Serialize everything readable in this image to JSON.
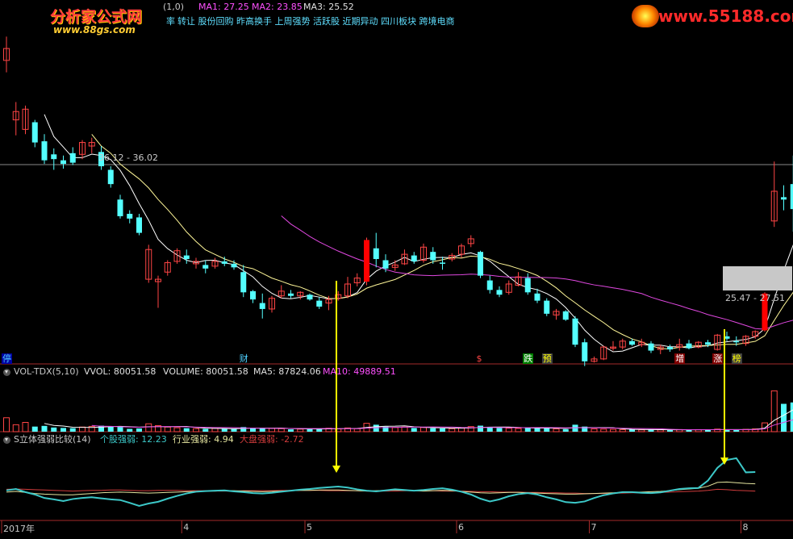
{
  "colors": {
    "bg": "#000000",
    "up": "#ff4545",
    "down": "#54ffff",
    "bigup": "#ff0000",
    "bigdown": "#00e600",
    "ma1": "#ffffff",
    "ma2": "#fff799",
    "ma3": "#e048e0",
    "grid": "#8b0000",
    "sep": "#a52a2a",
    "arrow": "#ffff00",
    "textGray": "#c8c8c8",
    "ind_stock": "#3cc8c8",
    "ind_industry": "#e6e6a0",
    "ind_market": "#d23c3c"
  },
  "header": {
    "title_fragment": "(1,0)",
    "ma1_text": "MA1: 27.25",
    "ma2_text": "MA2: 23.85",
    "ma3_text": "MA3: 25.52",
    "concepts_text": "转让 股份回购 昨高换手 上周强势 活跃股 近期异动 四川板块 跨境电商",
    "concepts_prefix": "率"
  },
  "watermarks": {
    "logo1": "分析家公式网",
    "logo1_url": "www.88gs.com",
    "logo2": "www.55188.com"
  },
  "price_panel": {
    "line_label": "36.12 - 36.02",
    "range_label": "25.47 - 27.51",
    "ylim": [
      20.5,
      47.5
    ],
    "event_tags": [
      {
        "text": "停",
        "color": "#4fd0ff",
        "bg": "#0000a0",
        "index": 0
      },
      {
        "text": "财",
        "color": "#4fd0ff",
        "bg": "",
        "index": 25
      },
      {
        "text": "$",
        "color": "#ff4545",
        "bg": "",
        "index": 50
      },
      {
        "text": "跌",
        "color": "#ffffff",
        "bg": "#008000",
        "index": 55
      },
      {
        "text": "预",
        "color": "#ffff00",
        "bg": "#404040",
        "index": 57
      },
      {
        "text": "增",
        "color": "#ffffff",
        "bg": "#800000",
        "index": 71
      },
      {
        "text": "涨",
        "color": "#ffffff",
        "bg": "#800000",
        "index": 75
      },
      {
        "text": "榜",
        "color": "#ffff00",
        "bg": "#404040",
        "index": 77
      }
    ]
  },
  "volume_panel": {
    "title": "VOL-TDX(5,10)",
    "vvol_text": "VVOL: 80051.58",
    "volume_text": "VOLUME: 80051.58",
    "ma5_text": "MA5: 87824.06",
    "ma10_text": "MA10: 49889.51",
    "ylim": [
      0,
      240000
    ]
  },
  "strength_panel": {
    "title": "S立体强弱比较(14)",
    "stock_text": "个股强弱: 12.23",
    "industry_text": "行业强弱: 4.94",
    "market_text": "大盘强弱: -2.72",
    "ylim": [
      -5,
      16
    ]
  },
  "x_axis": {
    "labels": [
      {
        "text": "2017年",
        "index": 0
      },
      {
        "text": "4",
        "index": 19
      },
      {
        "text": "5",
        "index": 32
      },
      {
        "text": "6",
        "index": 48
      },
      {
        "text": "7",
        "index": 62
      },
      {
        "text": "8",
        "index": 78
      }
    ]
  },
  "chart_data": {
    "type": "candlestick",
    "candles": [
      [
        45,
        47,
        44,
        46,
        60000
      ],
      [
        40,
        41.5,
        38.7,
        40.7,
        30000
      ],
      [
        39.2,
        41.2,
        38.8,
        40.9,
        40000
      ],
      [
        39.8,
        40,
        37.7,
        38.1,
        22000
      ],
      [
        38.2,
        38.8,
        36.3,
        36.6,
        25000
      ],
      [
        37.1,
        37.6,
        35.8,
        36.7,
        18000
      ],
      [
        36.6,
        37,
        35.9,
        36.3,
        16000
      ],
      [
        37.2,
        37.7,
        36.2,
        36.4,
        15000
      ],
      [
        37.1,
        38.3,
        36.7,
        38.1,
        20000
      ],
      [
        37.8,
        38.5,
        37.2,
        38.1,
        23000
      ],
      [
        37.3,
        37.8,
        35.8,
        36.1,
        26000
      ],
      [
        35.8,
        36.1,
        34.3,
        34.6,
        24000
      ],
      [
        33.3,
        33.7,
        31.7,
        31.9,
        22000
      ],
      [
        32.1,
        32.4,
        31.3,
        31.7,
        12000
      ],
      [
        31.8,
        32.1,
        30.3,
        30.5,
        14000
      ],
      [
        26.6,
        29.5,
        26.3,
        29.1,
        34000
      ],
      [
        26.4,
        26.9,
        24.2,
        26.6,
        26000
      ],
      [
        27.2,
        28.2,
        26.9,
        28,
        20000
      ],
      [
        28.1,
        29.2,
        27.9,
        29,
        17000
      ],
      [
        28.6,
        29.1,
        27.9,
        28.3,
        15000
      ],
      [
        27.9,
        28.4,
        27.5,
        28.1,
        13000
      ],
      [
        27.8,
        28.2,
        27.1,
        27.5,
        12000
      ],
      [
        27.7,
        28.4,
        27.5,
        28.1,
        14000
      ],
      [
        28.1,
        28.5,
        27.7,
        27.9,
        13000
      ],
      [
        27.9,
        28.2,
        27.4,
        27.6,
        12000
      ],
      [
        27.2,
        27.8,
        25.1,
        25.5,
        20000
      ],
      [
        25.6,
        25.7,
        24.6,
        24.9,
        16000
      ],
      [
        24.6,
        25.4,
        23.3,
        24.1,
        15000
      ],
      [
        24.1,
        25.2,
        23.8,
        25,
        14000
      ],
      [
        25.2,
        26.1,
        25,
        25.6,
        13000
      ],
      [
        25.4,
        25.7,
        25,
        25.2,
        10000
      ],
      [
        25.2,
        25.6,
        24.9,
        25.5,
        11000
      ],
      [
        25.3,
        25.4,
        24.8,
        24.9,
        12000
      ],
      [
        24.8,
        25.1,
        24.1,
        24.3,
        13000
      ],
      [
        24.6,
        25.2,
        24,
        24.9,
        15000
      ],
      [
        25,
        25.6,
        24.8,
        25.3,
        12000
      ],
      [
        25.2,
        26.8,
        25,
        26.2,
        16000
      ],
      [
        26.3,
        27.1,
        26,
        26.7,
        13000
      ],
      [
        26.4,
        30.1,
        26.1,
        29.9,
        36000
      ],
      [
        29.2,
        30.5,
        27.6,
        28.3,
        30000
      ],
      [
        28.2,
        28.7,
        27.2,
        27.5,
        22000
      ],
      [
        27.6,
        28.2,
        27.3,
        27.8,
        18000
      ],
      [
        27.9,
        29.1,
        27.8,
        28.7,
        20000
      ],
      [
        28.6,
        28.9,
        27.9,
        28.1,
        16000
      ],
      [
        28.2,
        29.6,
        28,
        29.3,
        18000
      ],
      [
        28.9,
        29.3,
        27.9,
        28.2,
        15000
      ],
      [
        28,
        28.5,
        27.4,
        27.9,
        14000
      ],
      [
        28.3,
        28.8,
        28.1,
        28.6,
        13000
      ],
      [
        28.7,
        29.6,
        28.4,
        29.4,
        16000
      ],
      [
        29.6,
        30.3,
        29.3,
        30,
        22000
      ],
      [
        28.9,
        29,
        26.7,
        26.9,
        26000
      ],
      [
        26.5,
        26.9,
        25.4,
        25.7,
        21000
      ],
      [
        25.7,
        26,
        25.1,
        25.3,
        16000
      ],
      [
        25.5,
        26.5,
        25.3,
        26.2,
        15000
      ],
      [
        26.1,
        27.2,
        26,
        26.8,
        14000
      ],
      [
        26.7,
        27.1,
        25.3,
        25.5,
        16000
      ],
      [
        25.4,
        25.8,
        24.6,
        24.8,
        18000
      ],
      [
        24.8,
        25,
        23.5,
        23.7,
        15000
      ],
      [
        23.6,
        24.1,
        23.2,
        23.9,
        12000
      ],
      [
        23.9,
        24,
        23.1,
        23.2,
        11000
      ],
      [
        23.3,
        23.5,
        20.9,
        21.1,
        30000
      ],
      [
        21.3,
        21.6,
        19.3,
        19.7,
        22000
      ],
      [
        19.7,
        20.1,
        19.6,
        19.9,
        12000
      ],
      [
        19.9,
        21,
        19.8,
        20.9,
        11000
      ],
      [
        20.8,
        21.4,
        20.6,
        20.9,
        10000
      ],
      [
        20.9,
        21.6,
        20.7,
        21.4,
        9000
      ],
      [
        21.4,
        21.6,
        21,
        21.1,
        9000
      ],
      [
        21.1,
        21.6,
        20.9,
        21.3,
        8000
      ],
      [
        21.2,
        21.4,
        20.4,
        20.6,
        9000
      ],
      [
        20.7,
        21.1,
        20.3,
        20.9,
        8000
      ],
      [
        20.9,
        21.1,
        20.5,
        20.7,
        8000
      ],
      [
        20.9,
        21.6,
        20.6,
        21.1,
        9000
      ],
      [
        21.2,
        21.5,
        20.7,
        20.8,
        8000
      ],
      [
        20.9,
        21.4,
        20.8,
        21.3,
        9000
      ],
      [
        21.3,
        21.5,
        20.9,
        21.1,
        8000
      ],
      [
        20.7,
        22,
        20.6,
        21.9,
        11000
      ],
      [
        21.8,
        22.2,
        21.4,
        21.6,
        9000
      ],
      [
        21.4,
        21.8,
        21,
        21.3,
        8000
      ],
      [
        21.2,
        21.9,
        21,
        21.8,
        10000
      ],
      [
        21.8,
        22.3,
        21.6,
        22.2,
        12000
      ],
      [
        22.3,
        25.5,
        22.2,
        25.4,
        38000
      ],
      [
        31.5,
        36.5,
        31,
        34,
        176000
      ],
      [
        33.5,
        34.5,
        32.4,
        33.3,
        120000
      ],
      [
        34.6,
        37,
        30.6,
        32.5,
        126000
      ],
      [
        29.6,
        31.1,
        29.2,
        30,
        90000
      ]
    ],
    "ma1": [],
    "ma2": [],
    "ma3": [],
    "vol_ma5": [],
    "vol_ma10": [],
    "strength_stock": [
      3,
      3.4,
      2.5,
      1.8,
      0.8,
      0.4,
      -0.1,
      0.5,
      0.8,
      1,
      0.7,
      0.4,
      0.2,
      -0.6,
      -1.5,
      -0.8,
      -0.3,
      0.6,
      1.4,
      2.1,
      2.6,
      2.8,
      2.9,
      3,
      2.7,
      2.5,
      2.2,
      2.1,
      2.3,
      2.6,
      2.9,
      3.2,
      3.4,
      3.7,
      3.9,
      4.1,
      3.8,
      3.3,
      2.9,
      2.7,
      3,
      3.3,
      3.1,
      2.9,
      3.1,
      3.4,
      3.6,
      3.2,
      2.6,
      1.8,
      0.6,
      -0.2,
      0.4,
      1.3,
      1.9,
      2.2,
      1.8,
      1,
      0.4,
      -0.4,
      -0.6,
      -0.2,
      0.8,
      1.6,
      2.1,
      2.5,
      2.5,
      2.3,
      2.2,
      2.4,
      2.9,
      3.4,
      3.6,
      3.7,
      5.8,
      9.5,
      11.8,
      12.3,
      8.2,
      8.3
    ],
    "strength_industry": [
      2.5,
      2.7,
      2.4,
      2.1,
      1.9,
      1.8,
      1.7,
      1.7,
      1.9,
      2.1,
      2.3,
      2.4,
      2.5,
      2.4,
      2.3,
      2.2,
      2.3,
      2.4,
      2.5,
      2.6,
      2.7,
      2.8,
      2.8,
      2.9,
      2.9,
      2.8,
      2.7,
      2.6,
      2.7,
      2.8,
      2.9,
      3,
      3,
      3.1,
      3.1,
      3.1,
      3,
      2.9,
      2.8,
      2.9,
      3,
      3.1,
      3,
      2.9,
      2.8,
      2.9,
      3,
      2.9,
      2.7,
      2.5,
      2.3,
      2.2,
      2.3,
      2.4,
      2.4,
      2.3,
      2.2,
      2.1,
      2,
      1.9,
      1.9,
      2,
      2.1,
      2.2,
      2.3,
      2.4,
      2.5,
      2.5,
      2.6,
      2.7,
      2.9,
      3.2,
      3.4,
      3.6,
      4.2,
      5.3,
      5.4,
      5.2,
      5,
      4.9
    ],
    "strength_market": [
      3.3,
      3.4,
      3.3,
      3.2,
      3.1,
      3,
      2.9,
      2.8,
      2.9,
      3,
      3,
      3.1,
      3.1,
      3,
      2.9,
      2.9,
      3,
      3,
      3,
      2.9,
      2.9,
      2.9,
      2.8,
      2.8,
      2.8,
      2.9,
      2.9,
      2.9,
      2.9,
      3,
      3,
      3,
      3,
      3,
      2.9,
      2.9,
      2.9,
      2.9,
      2.8,
      2.8,
      2.8,
      2.8,
      2.9,
      2.9,
      2.9,
      2.9,
      2.8,
      2.8,
      2.8,
      2.7,
      2.6,
      2.6,
      2.5,
      2.5,
      2.5,
      2.4,
      2.4,
      2.3,
      2.3,
      2.2,
      2.2,
      2.1,
      2.1,
      2.1,
      2.2,
      2.2,
      2.3,
      2.3,
      2.3,
      2.4,
      2.5,
      2.6,
      2.7,
      2.8,
      3,
      3.3,
      3.2,
      3,
      2.9,
      2.8
    ]
  }
}
